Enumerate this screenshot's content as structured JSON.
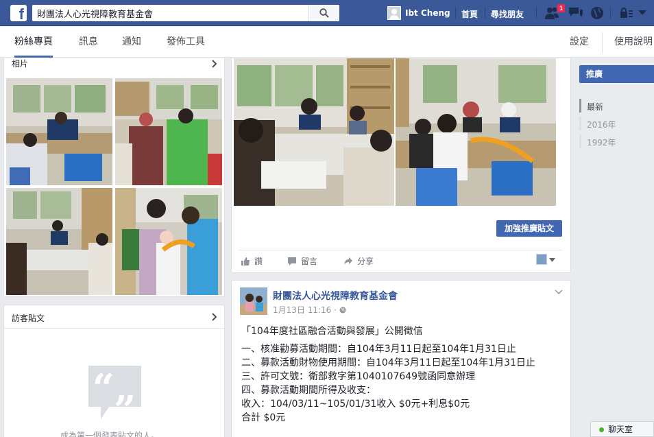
{
  "topbar": {
    "logo": "f",
    "search_value": "財團法人心光視障教育基金會",
    "user_name": "Ibt Cheng",
    "home_label": "首頁",
    "find_friends_label": "尋找朋友",
    "friend_requests_count": "1",
    "icons": [
      "facebook-logo",
      "search-icon",
      "friend-requests-icon",
      "messages-icon",
      "notifications-globe-icon",
      "privacy-lock-icon",
      "account-menu-icon"
    ],
    "brand_color": "#3b5998"
  },
  "tabs": {
    "items": [
      {
        "label": "粉絲專頁",
        "active": true
      },
      {
        "label": "訊息",
        "active": false
      },
      {
        "label": "通知",
        "active": false
      },
      {
        "label": "發佈工具",
        "active": false
      }
    ],
    "settings_label": "設定",
    "help_label": "使用說明"
  },
  "photos_card": {
    "title": "相片"
  },
  "visitor_posts_card": {
    "title": "訪客貼文",
    "empty_text": "成為第一個發表貼文的人。"
  },
  "post1": {
    "boost_label": "加強推廣貼文",
    "like_label": "讚",
    "comment_label": "留言",
    "share_label": "分享"
  },
  "post2": {
    "page_name": "財團法人心光視障教育基金會",
    "timestamp": "1月13日 11:16 · ",
    "lines": [
      "「104年度社區融合活動與發展」公開徵信",
      "一、核准勸募活動期間：自104年3月11日起至104年1月31日止",
      "二、募款活動財物使用期間：自104年3月11日起至104年1月31日止",
      "三、許可文號：衛部救字第1040107649號函同意辦理",
      "四、募款活動期間所得及收支：",
      "收入：104/03/11~105/01/31收入 $0元+利息$0元",
      "合計 $0元"
    ]
  },
  "sidebar": {
    "promote_label": "推廣",
    "years": [
      "最新",
      "2016年",
      "1992年"
    ]
  },
  "chat": {
    "label": "聊天室"
  },
  "colors": {
    "accent": "#4267b2",
    "link": "#365899",
    "background": "#e9ebee",
    "online": "#42b72a"
  }
}
